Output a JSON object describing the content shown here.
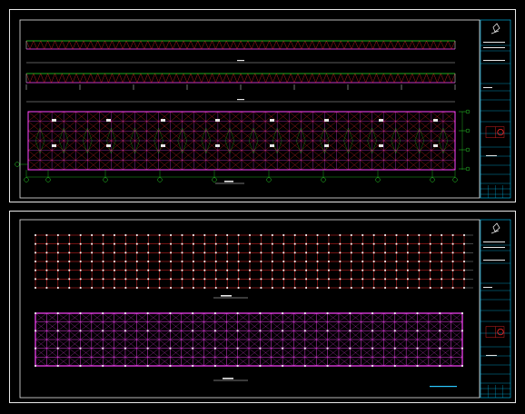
{
  "colors": {
    "background": "#000000",
    "frame": "#e8e8e8",
    "truss_top": "#27e627",
    "truss_web": "#ff2a2a",
    "truss_bottom": "#ff44ff",
    "grid_axis": "#2ad42a",
    "titleblock_line": "#00c8ff",
    "stamp": "#ff2a2a"
  },
  "icons": {
    "titleblock_logo": "company-logo-icon",
    "stamp": "red-seal-icon",
    "axis_bubble": "axis-bubble-icon"
  }
}
